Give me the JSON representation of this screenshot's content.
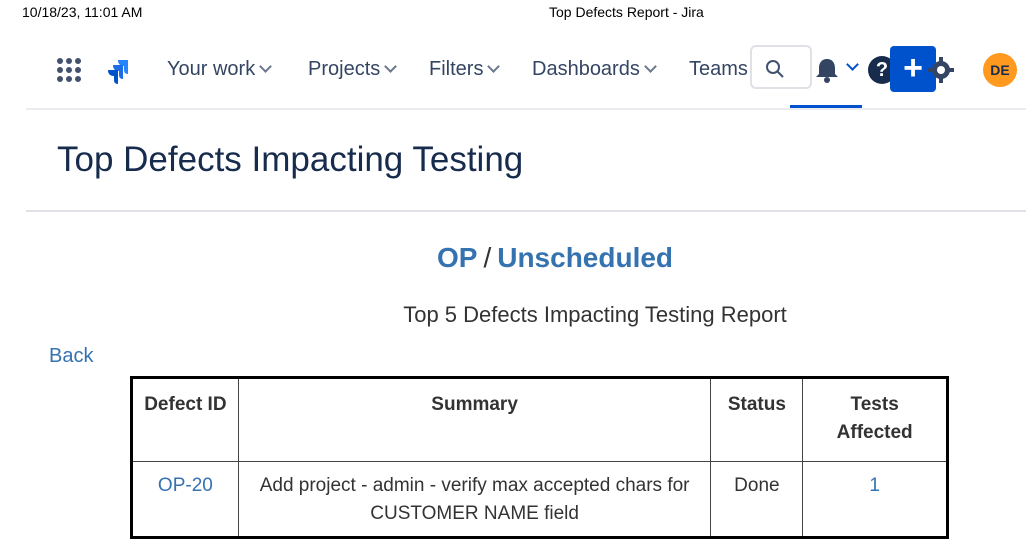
{
  "print_header": {
    "datetime": "10/18/23, 11:01 AM",
    "document_title": "Top Defects Report - Jira"
  },
  "nav": {
    "items": [
      {
        "label": "Your work"
      },
      {
        "label": "Projects"
      },
      {
        "label": "Filters"
      },
      {
        "label": "Dashboards"
      },
      {
        "label": "Teams"
      }
    ],
    "search_icon": "search-icon",
    "help_label": "?",
    "create_label": "+",
    "avatar_initials": "DE",
    "accent_color": "#0052cc",
    "avatar_color": "#ff991f"
  },
  "page": {
    "title": "Top Defects Impacting Testing"
  },
  "report": {
    "project": "OP",
    "separator": "/",
    "version": "Unscheduled",
    "title": "Top 5 Defects Impacting Testing Report",
    "back_label": "Back",
    "columns": [
      "Defect ID",
      "Summary",
      "Status",
      "Tests Affected"
    ],
    "rows": [
      {
        "defect_id": "OP-20",
        "summary": "Add project - admin - verify max accepted chars for CUSTOMER NAME field",
        "status": "Done",
        "tests_affected": "1"
      }
    ]
  }
}
